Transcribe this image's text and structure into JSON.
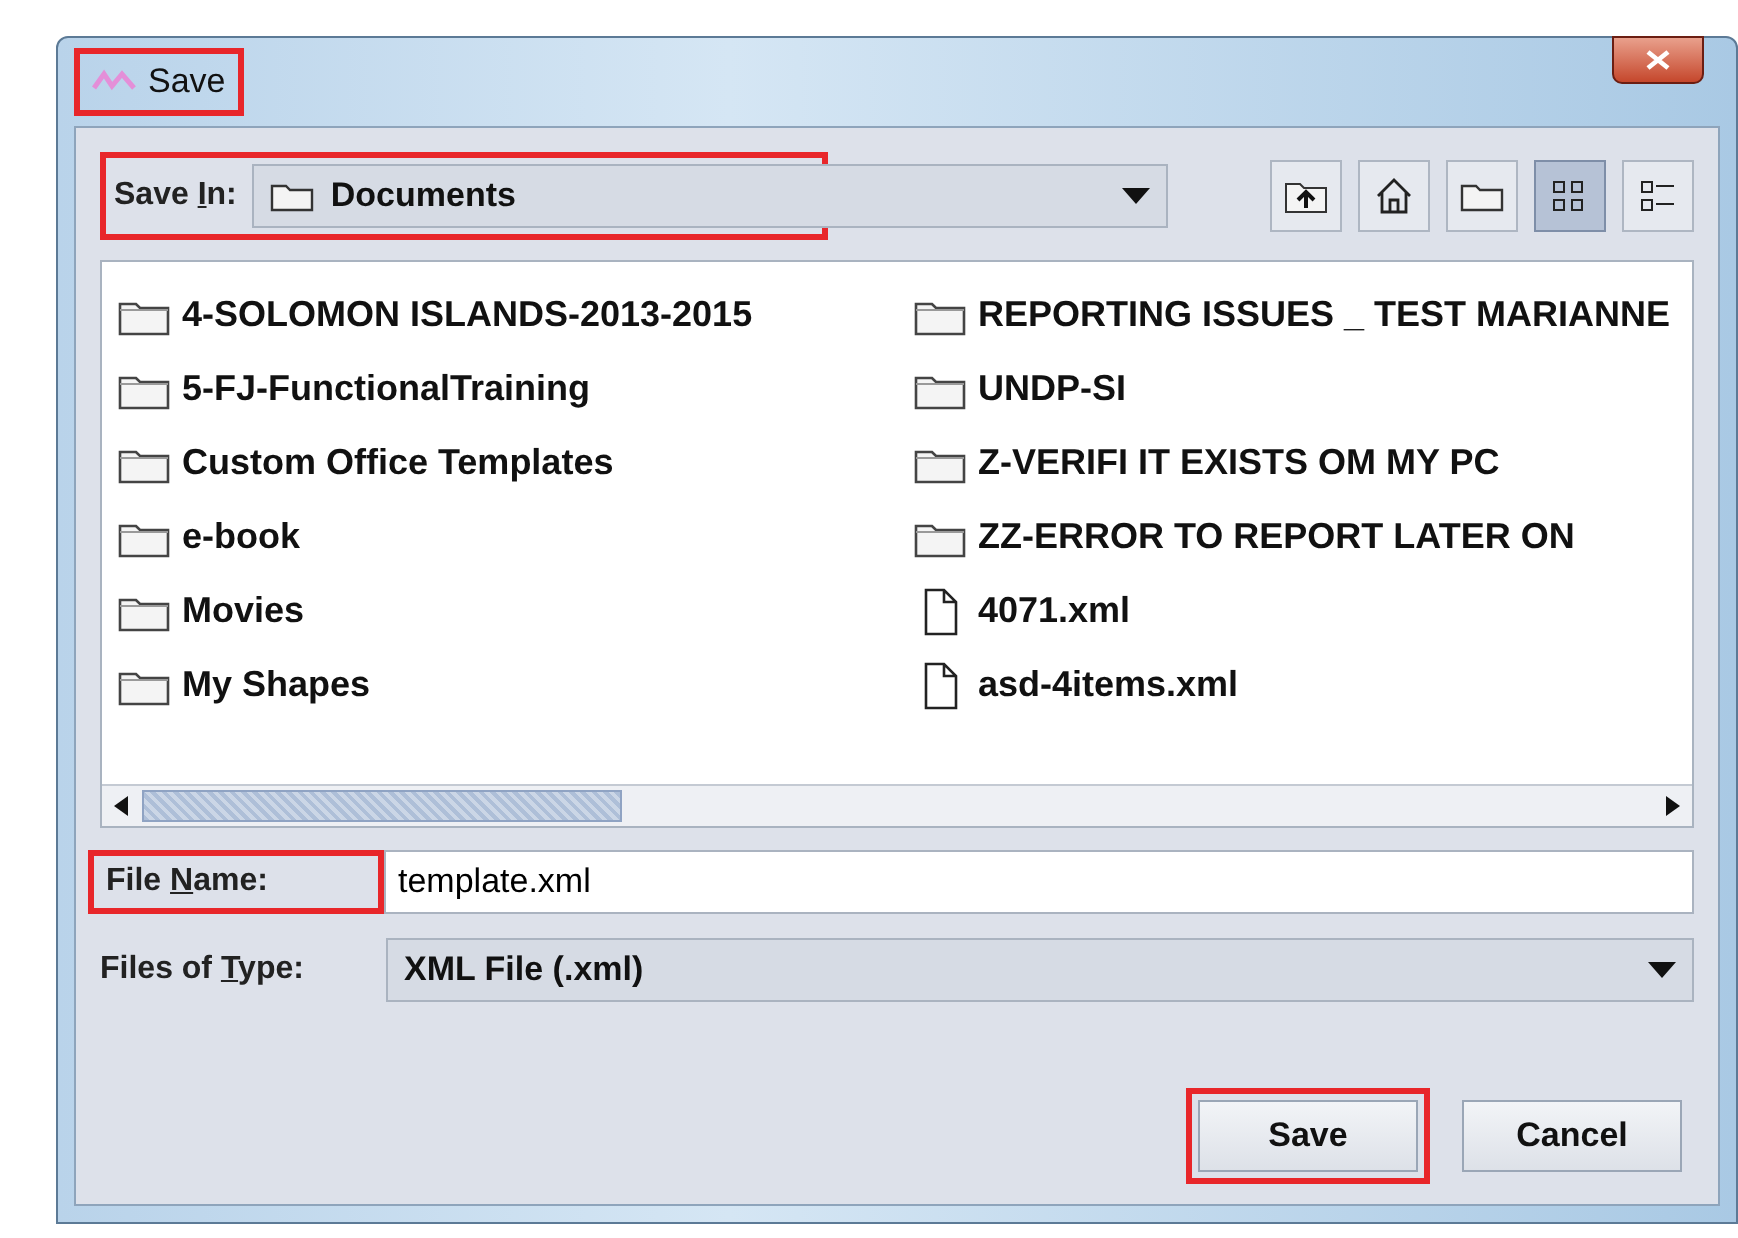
{
  "window": {
    "title": "Save",
    "highlighted": true
  },
  "save_in": {
    "label": {
      "before": "Save ",
      "key": "I",
      "after": "n:"
    },
    "value": "Documents",
    "highlighted": true
  },
  "toolbar": [
    {
      "kind": "up",
      "selected": false
    },
    {
      "kind": "home",
      "selected": false
    },
    {
      "kind": "newfolder",
      "selected": false
    },
    {
      "kind": "list",
      "selected": true
    },
    {
      "kind": "details",
      "selected": false
    }
  ],
  "files": [
    {
      "name": "4-SOLOMON ISLANDS-2013-2015",
      "kind": "folder"
    },
    {
      "name": "5-FJ-FunctionalTraining",
      "kind": "folder"
    },
    {
      "name": "Custom Office Templates",
      "kind": "folder"
    },
    {
      "name": "e-book",
      "kind": "folder"
    },
    {
      "name": "Movies",
      "kind": "folder"
    },
    {
      "name": "My Shapes",
      "kind": "folder"
    },
    {
      "name": "REPORTING ISSUES _ TEST MARIANNE",
      "kind": "folder"
    },
    {
      "name": "UNDP-SI",
      "kind": "folder"
    },
    {
      "name": "Z-VERIFI IT EXISTS OM MY PC",
      "kind": "folder"
    },
    {
      "name": "ZZ-ERROR TO REPORT LATER ON",
      "kind": "folder"
    },
    {
      "name": "4071.xml",
      "kind": "file"
    },
    {
      "name": "asd-4items.xml",
      "kind": "file"
    }
  ],
  "file_name": {
    "label": {
      "before": "File ",
      "key": "N",
      "after": "ame:"
    },
    "value": "template.xml",
    "highlighted": true
  },
  "file_type": {
    "label": {
      "before": "Files of ",
      "key": "T",
      "after": "ype:"
    },
    "value": "XML File (.xml)"
  },
  "buttons": [
    {
      "label": "Save",
      "highlighted": true
    },
    {
      "label": "Cancel",
      "highlighted": false
    }
  ]
}
